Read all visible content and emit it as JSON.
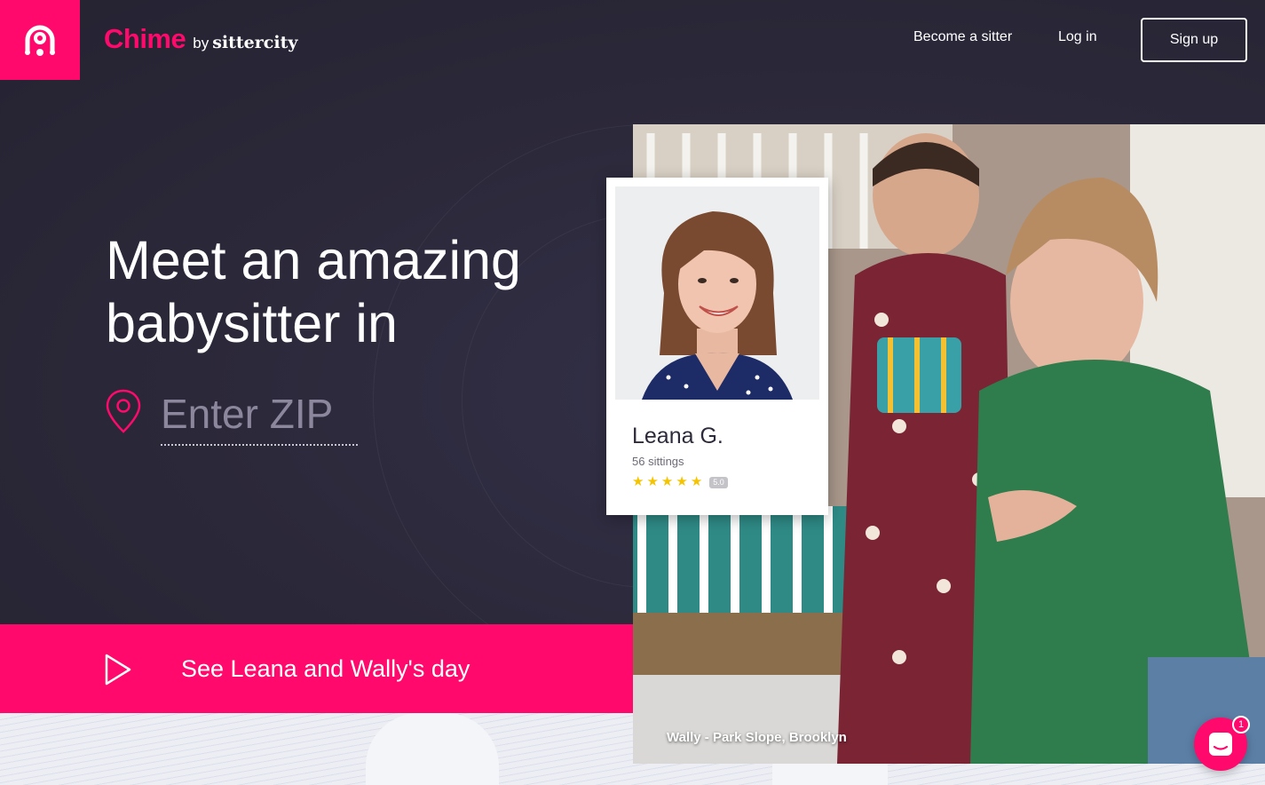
{
  "header": {
    "brand_name": "Chime",
    "brand_by": "by",
    "brand_partner": "sittercity",
    "nav": [
      {
        "label": "Become a sitter"
      },
      {
        "label": "Log in"
      }
    ],
    "signup_label": "Sign up"
  },
  "hero": {
    "headline_line1": "Meet an amazing",
    "headline_line2": "babysitter in",
    "zip_placeholder": "Enter ZIP"
  },
  "video_cta": {
    "label": "See Leana and Wally's day"
  },
  "sitter_card": {
    "name": "Leana G.",
    "sittings": "56 sittings",
    "rating": "5.0",
    "stars": 5
  },
  "photo": {
    "caption": "Wally - Park Slope, Brooklyn"
  },
  "chat": {
    "badge_count": "1"
  },
  "colors": {
    "brand": "#ff0a6c",
    "background": "#2d2a3b",
    "star": "#f5c400"
  }
}
